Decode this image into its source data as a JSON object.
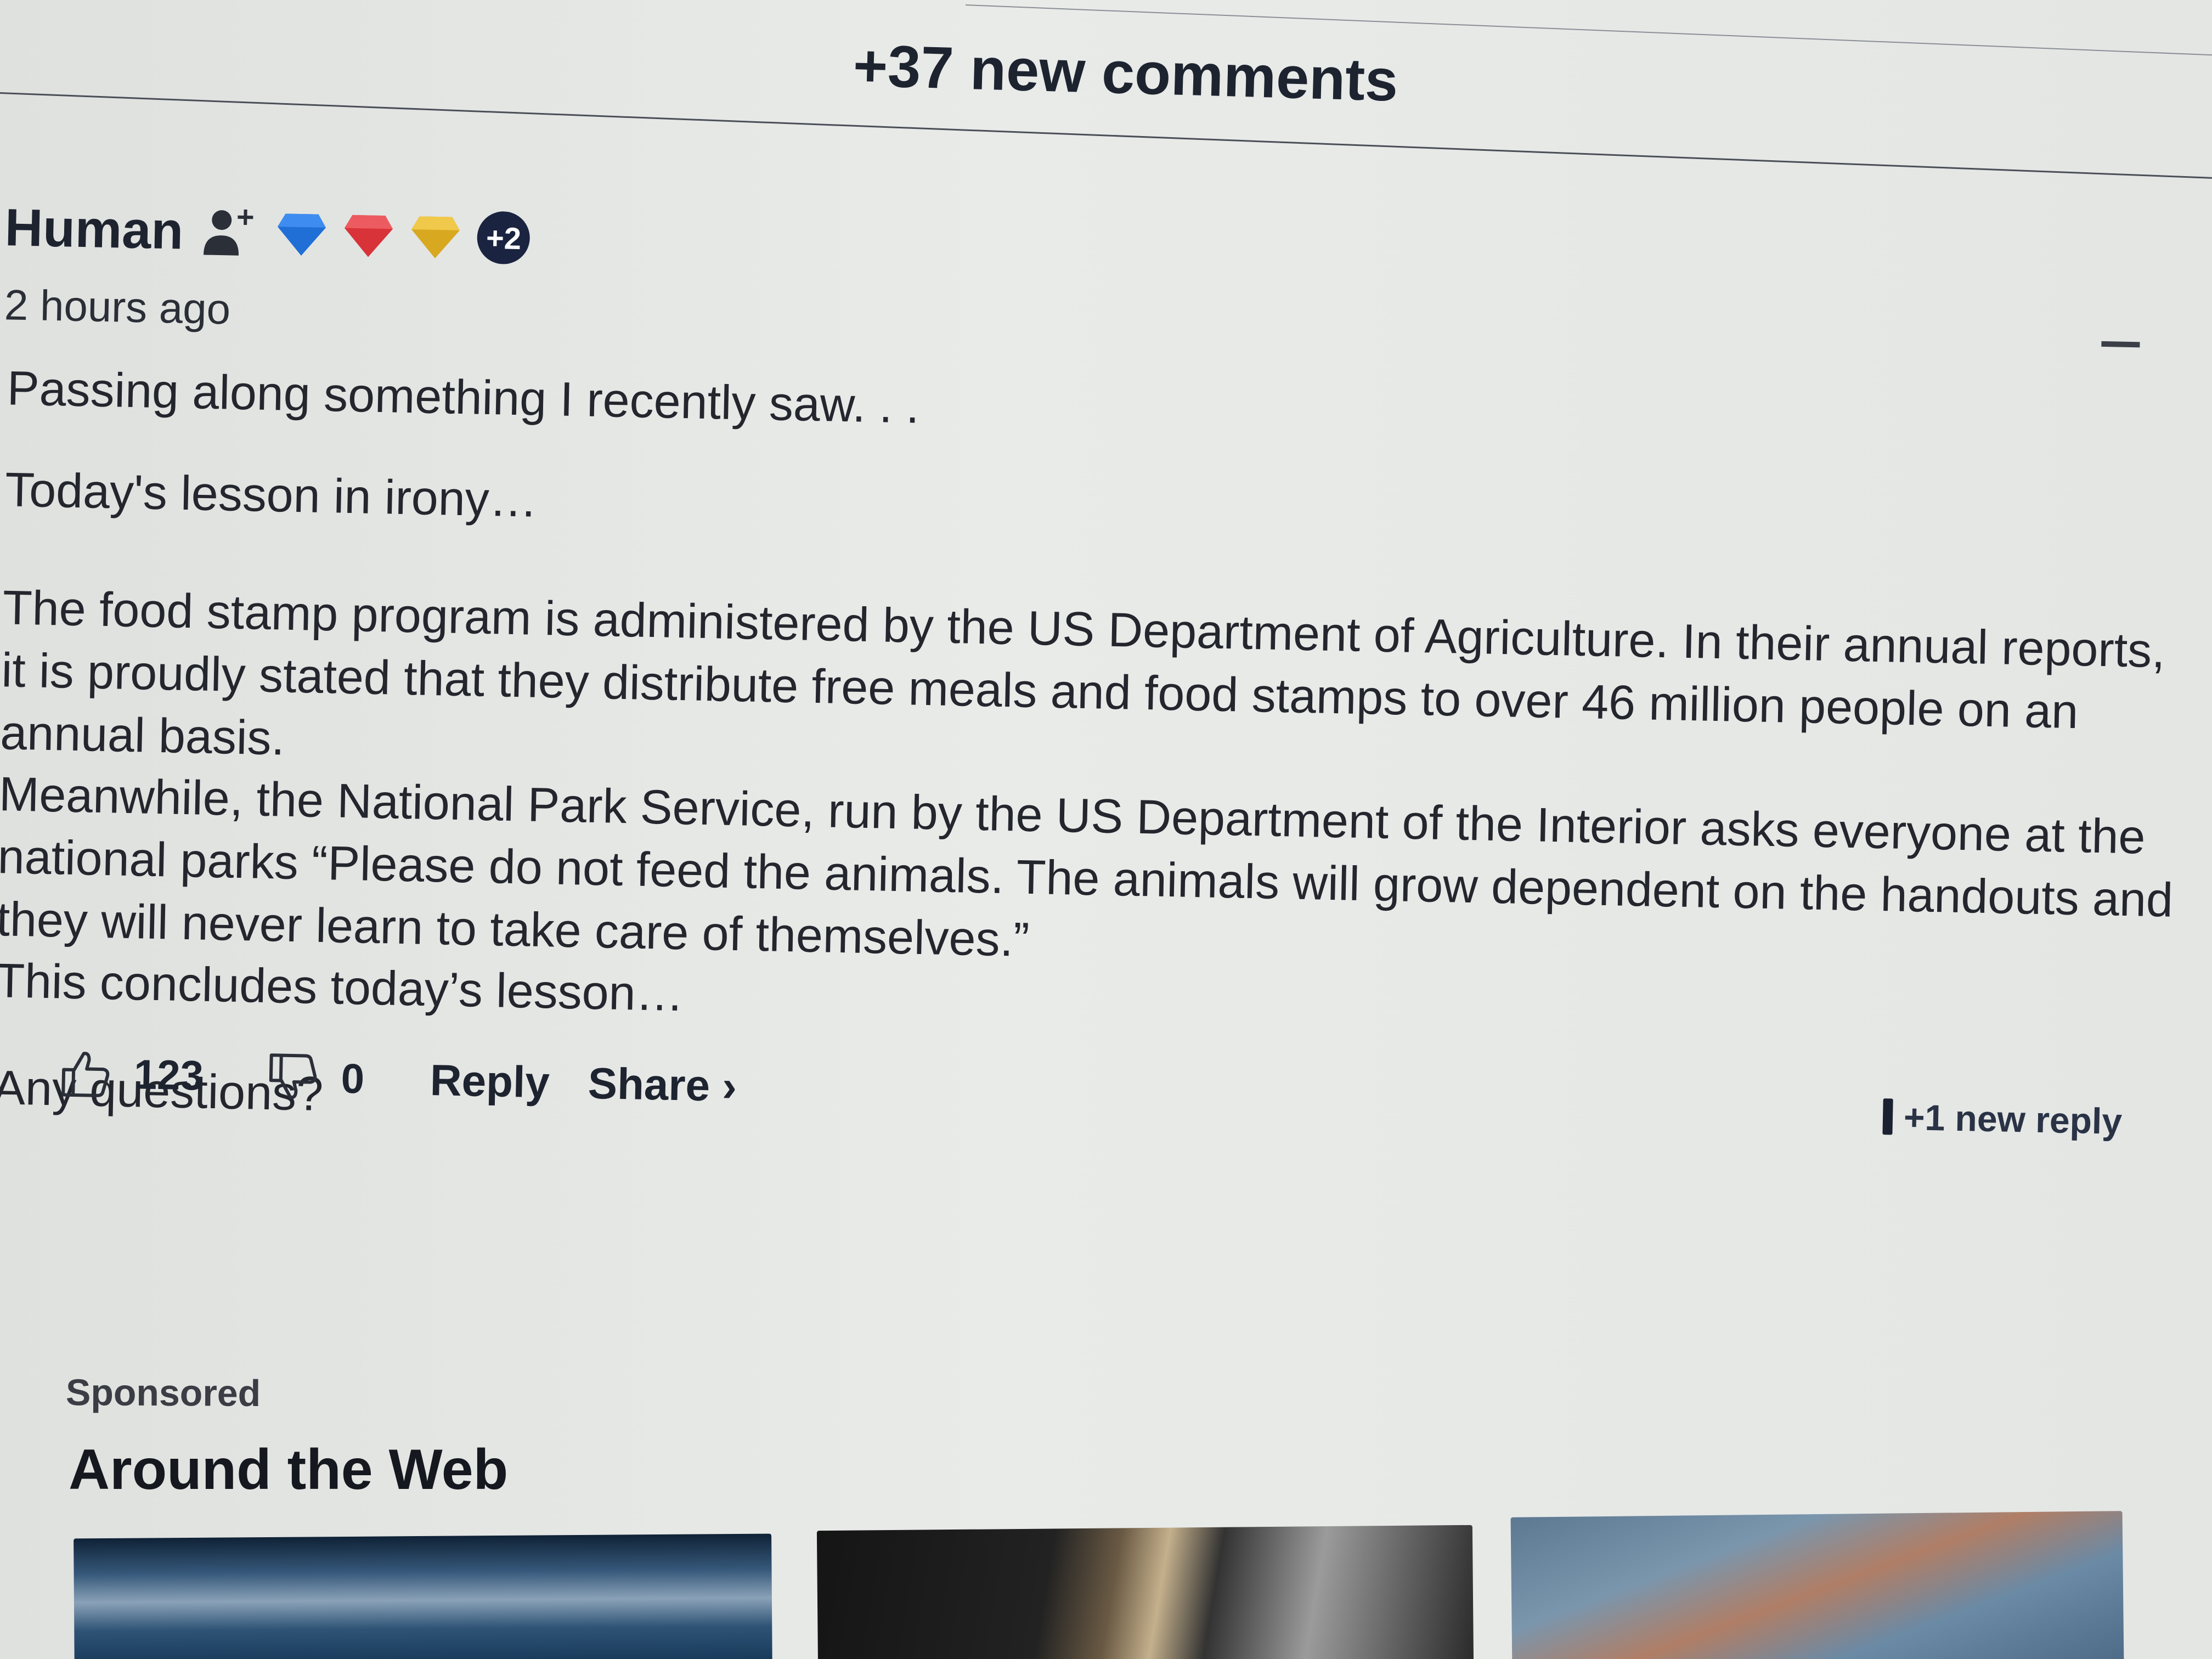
{
  "new_comments_label": "+37 new comments",
  "comment": {
    "author": "Human",
    "badge_more": "+2",
    "timestamp": "2 hours ago",
    "paragraphs": [
      "Passing along something I recently saw. . .",
      "Today's lesson in irony…",
      "The food stamp program is administered by the US Department of Agriculture. In their annual reports, it is proudly stated that they distribute free meals and food stamps to over 46 million people on an annual basis.",
      "Meanwhile, the National Park Service, run by the US Department of the Interior asks everyone at the national parks “Please do not feed the animals. The animals will grow dependent on the handouts and they will never learn to take care of themselves.”",
      "This concludes today’s lesson…",
      "Any questions?"
    ],
    "badges": [
      {
        "name": "blue-diamond-icon",
        "color": "#1f6fd6"
      },
      {
        "name": "red-diamond-icon",
        "color": "#d9333a"
      },
      {
        "name": "gold-diamond-icon",
        "color": "#e0b32a"
      }
    ],
    "actions": {
      "likes": "123",
      "dislikes": "0",
      "reply_label": "Reply",
      "share_label": "Share ›"
    },
    "new_reply_label": "+1 new reply"
  },
  "sponsored": {
    "label": "Sponsored",
    "title": "Around the Web"
  }
}
